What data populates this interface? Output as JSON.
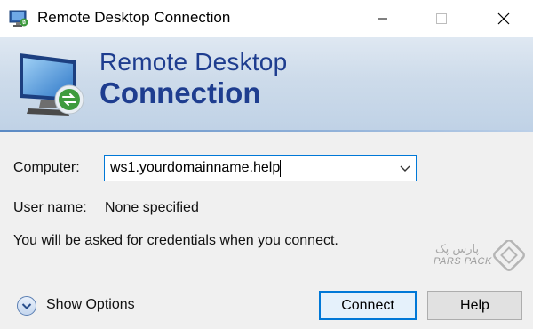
{
  "window": {
    "title": "Remote Desktop Connection",
    "controls": {
      "minimize_icon": "minimize-icon",
      "maximize_icon": "maximize-icon",
      "close_icon": "close-icon"
    }
  },
  "banner": {
    "line1": "Remote Desktop",
    "line2": "Connection",
    "title_color": "#1e3d8f",
    "icon": "remote-desktop-monitor-icon"
  },
  "form": {
    "computer_label": "Computer:",
    "computer_value": "ws1.yourdomainname.help",
    "username_label": "User name:",
    "username_value": "None specified",
    "note": "You will be asked for credentials when you connect."
  },
  "footer": {
    "show_options_label": "Show Options",
    "connect_label": "Connect",
    "help_label": "Help"
  },
  "watermark": {
    "text_latin": "PARS PACK",
    "logo": "parspack-logo"
  },
  "colors": {
    "accent": "#0078d7",
    "background": "#f0f0f0"
  }
}
